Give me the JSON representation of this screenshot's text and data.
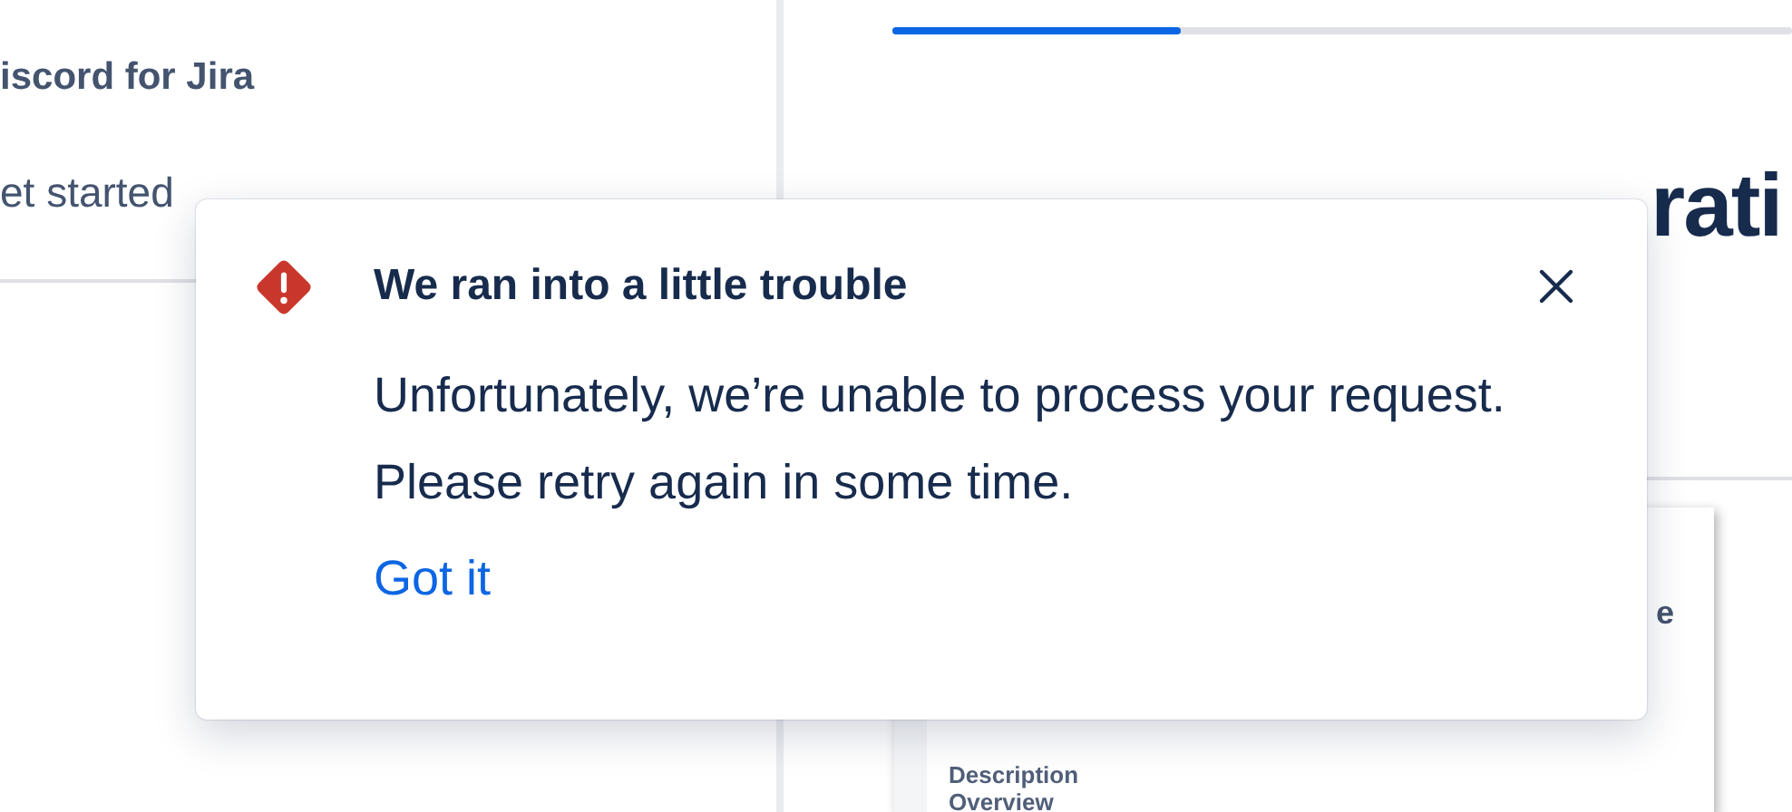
{
  "sidebar": {
    "title": "iscord for Jira",
    "items": [
      {
        "label": "et started"
      }
    ]
  },
  "progress": {
    "level": 0.32
  },
  "page": {
    "heading": "rati",
    "preview": {
      "side_text": "e",
      "section": "Description",
      "subsection": "Overview"
    }
  },
  "dialog": {
    "title": "We ran into a little trouble",
    "message": "Unfortunately, we’re unable to process your request. Please retry again in some time.",
    "action": "Got it"
  }
}
